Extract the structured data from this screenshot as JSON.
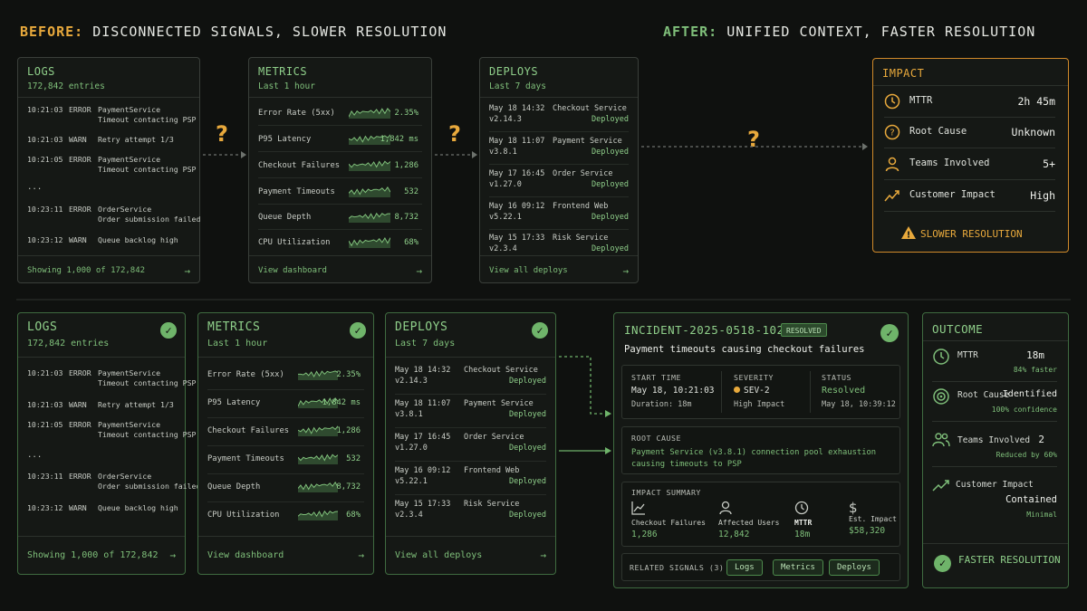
{
  "before_header": {
    "keyword": "BEFORE:",
    "text": "DISCONNECTED SIGNALS, SLOWER RESOLUTION"
  },
  "after_header": {
    "keyword": "AFTER:",
    "text": "UNIFIED CONTEXT, FASTER RESOLUTION"
  },
  "logs": {
    "title": "LOGS",
    "subtitle": "172,842 entries",
    "entries": [
      {
        "time": "10:21:03",
        "level": "ERROR",
        "service": "PaymentService",
        "message": "Timeout contacting PSP"
      },
      {
        "time": "10:21:03",
        "level": "WARN",
        "service": "Retry attempt 1/3",
        "message": ""
      },
      {
        "time": "10:21:05",
        "level": "ERROR",
        "service": "PaymentService",
        "message": "Timeout contacting PSP"
      },
      {
        "time": "10:23:11",
        "level": "ERROR",
        "service": "OrderService",
        "message": "Order submission failed"
      },
      {
        "time": "10:23:12",
        "level": "WARN",
        "service": "Queue backlog high",
        "message": ""
      }
    ],
    "ellipsis": "...",
    "after_message_4": "Order submission failed",
    "footer": "Showing 1,000 of 172,842"
  },
  "metrics": {
    "title": "METRICS",
    "subtitle": "Last 1 hour",
    "rows": [
      {
        "label": "Error Rate (5xx)",
        "value": "2.35%"
      },
      {
        "label": "P95 Latency",
        "value": "1,842 ms"
      },
      {
        "label": "Checkout Failures",
        "value": "1,286"
      },
      {
        "label": "Payment Timeouts",
        "value": "532"
      },
      {
        "label": "Queue Depth",
        "value": "8,732"
      },
      {
        "label": "CPU Utilization",
        "value": "68%"
      }
    ],
    "footer": "View dashboard"
  },
  "deploys": {
    "title": "DEPLOYS",
    "subtitle": "Last 7 days",
    "rows": [
      {
        "date": "May 18 14:32",
        "version": "v2.14.3",
        "service": "Checkout Service",
        "status": "Deployed"
      },
      {
        "date": "May 18 11:07",
        "version": "v3.8.1",
        "service": "Payment Service",
        "status": "Deployed"
      },
      {
        "date": "May 17 16:45",
        "version": "v1.27.0",
        "service": "Order Service",
        "status": "Deployed"
      },
      {
        "date": "May 16 09:12",
        "version": "v5.22.1",
        "service": "Frontend Web",
        "status": "Deployed"
      },
      {
        "date": "May 15 17:33",
        "version": "v2.3.4",
        "service": "Risk Service",
        "status": "Deployed"
      }
    ],
    "footer": "View all deploys"
  },
  "question_mark": "?",
  "impact": {
    "title": "IMPACT",
    "rows": [
      {
        "label": "MTTR",
        "value": "2h 45m"
      },
      {
        "label": "Root Cause",
        "value": "Unknown"
      },
      {
        "label": "Teams Involved",
        "value": "5+"
      },
      {
        "label": "Customer Impact",
        "value": "High"
      }
    ],
    "footer": "SLOWER RESOLUTION"
  },
  "check_glyph": "✓",
  "warning_glyph": "!",
  "arrow_glyph": "→",
  "incident": {
    "id": "INCIDENT-2025-0518-1021",
    "badge": "RESOLVED",
    "summary": "Payment timeouts causing checkout failures",
    "start_time_label": "START TIME",
    "start_time": "May 18, 10:21:03",
    "duration": "Duration: 18m",
    "severity_label": "SEVERITY",
    "severity": "SEV-2",
    "severity_desc": "High Impact",
    "status_label": "STATUS",
    "status": "Resolved",
    "status_time": "May 18, 10:39:12",
    "root_cause_label": "ROOT CAUSE",
    "root_cause_line1": "Payment Service (v3.8.1) connection pool exhaustion",
    "root_cause_line2": "causing timeouts to PSP",
    "impact_summary_label": "IMPACT SUMMARY",
    "impact_items": [
      {
        "label": "Checkout Failures",
        "value": "1,286"
      },
      {
        "label": "Affected Users",
        "value": "12,842"
      },
      {
        "label": "MTTR",
        "value": "18m"
      },
      {
        "label": "Est. Impact",
        "value": "$58,320"
      }
    ],
    "related_label": "RELATED SIGNALS (3)",
    "related": [
      "Logs",
      "Metrics",
      "Deploys"
    ]
  },
  "outcome": {
    "title": "OUTCOME",
    "mttr_label": "MTTR",
    "mttr_value": "18m",
    "mttr_sub": "84% faster",
    "root_label": "Root Cause",
    "root_value": "Identified",
    "root_sub": "100% confidence",
    "teams_label": "Teams Involved",
    "teams_value": "2",
    "teams_sub": "Reduced by 60%",
    "cust_label": "Customer Impact",
    "cust_value": "Contained",
    "cust_sub": "Minimal",
    "footer": "FASTER RESOLUTION"
  },
  "colors": {
    "accent_green": "#7fbf7a",
    "accent_orange": "#e8a93c",
    "background": "#0f110f"
  }
}
